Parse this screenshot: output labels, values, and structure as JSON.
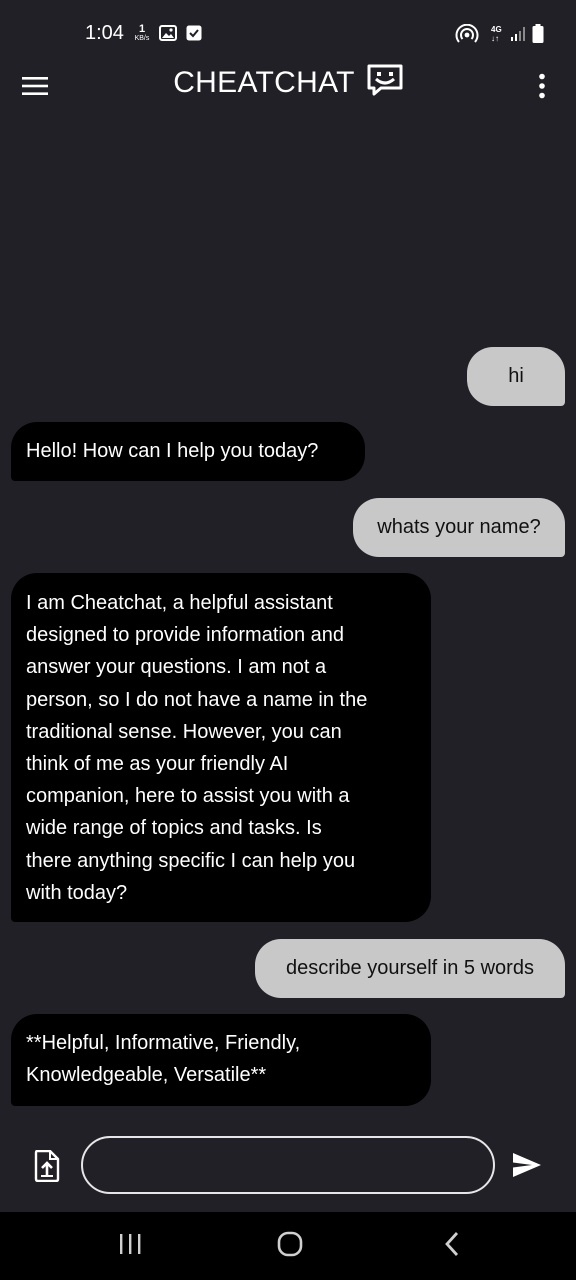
{
  "status_bar": {
    "time": "1:04",
    "net_speed_value": "1",
    "net_speed_unit": "KB/s",
    "network_type_top": "4G",
    "network_type_bottom": "↓↑",
    "icons": [
      "gallery-icon",
      "check-icon",
      "hotspot-icon",
      "signal-icon",
      "battery-icon"
    ]
  },
  "app_bar": {
    "title": "CHEATCHAT",
    "menu_icon": "hamburger-icon",
    "logo_icon": "chat-smiley-icon",
    "more_icon": "more-vertical-icon"
  },
  "messages": [
    {
      "role": "user",
      "text": "hi"
    },
    {
      "role": "bot",
      "text": "Hello! How can I help you today?"
    },
    {
      "role": "user",
      "text": "whats your name?"
    },
    {
      "role": "bot",
      "text": "I am Cheatchat, a helpful assistant\ndesigned to provide information and\nanswer your questions. I am not a\nperson, so I do not have a name in the\ntraditional sense. However, you can\nthink of me as your friendly AI\ncompanion, here to assist you with a\nwide range of topics and tasks. Is\nthere anything specific I can help you\nwith today?"
    },
    {
      "role": "user",
      "text": "describe yourself in 5 words"
    },
    {
      "role": "bot",
      "text": "**Helpful, Informative, Friendly,\nKnowledgeable, Versatile**"
    }
  ],
  "composer": {
    "input_value": "",
    "input_placeholder": "",
    "attach_icon": "file-upload-icon",
    "send_icon": "send-icon"
  },
  "nav_bar": {
    "icons": [
      "recent-apps-icon",
      "home-icon",
      "back-icon"
    ]
  },
  "colors": {
    "background": "#212027",
    "user_bubble": "#c8c8c8",
    "bot_bubble": "#000000",
    "nav_bar": "#000000"
  }
}
